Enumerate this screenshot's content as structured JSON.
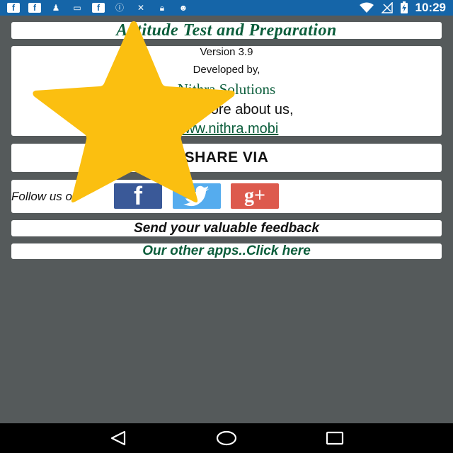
{
  "status_bar": {
    "time": "10:29",
    "icons": [
      "facebook-icon",
      "facebook-icon",
      "chess-pawn-icon",
      "card-icon",
      "facebook-icon",
      "info-circle-icon",
      "no-signal-icon",
      "lock-icon",
      "android-icon"
    ],
    "right_icons": [
      "wifi-icon",
      "cell-signal-icon",
      "battery-charging-icon"
    ],
    "color": "#1565a8"
  },
  "header": {
    "title": "Aptitude Test and Preparation"
  },
  "about": {
    "version": "Version 3.9",
    "developed_by": "Developed by,",
    "company": "Nithra Solutions",
    "know_more": "Know more about us,",
    "website": "www.nithra.mobi"
  },
  "share": {
    "label": "SHARE VIA"
  },
  "follow": {
    "label": "Follow us on",
    "facebook_glyph": "f",
    "googleplus_glyph": "g+"
  },
  "feedback": {
    "label": "Send your valuable feedback"
  },
  "other_apps": {
    "label": "Our other apps..Click here"
  },
  "overlay": {
    "icon": "star-icon",
    "color": "#fbbf10"
  },
  "nav_bar": {
    "icons": [
      "back-icon",
      "home-icon",
      "recents-icon"
    ]
  },
  "colors": {
    "background": "#555a5b",
    "accent_green": "#0b5d3b",
    "facebook": "#3a5998",
    "twitter": "#55acee",
    "googleplus": "#dd5a4d"
  }
}
